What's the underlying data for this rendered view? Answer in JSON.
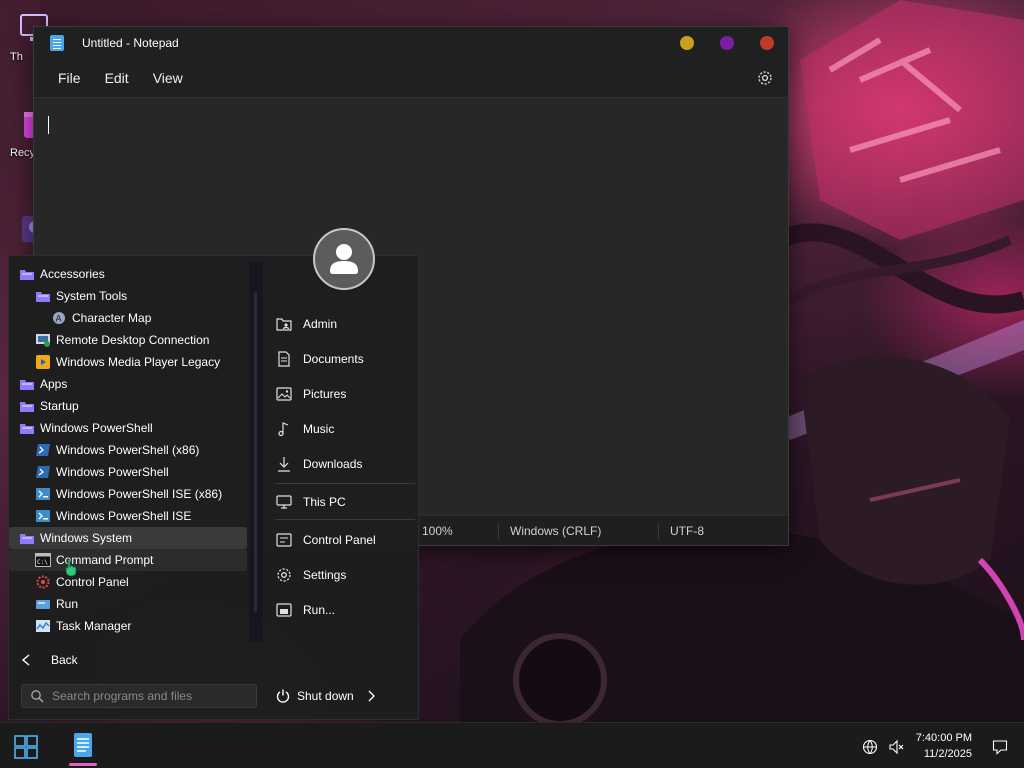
{
  "desktop": {
    "icons": [
      {
        "label": "Th",
        "icon": "this-pc-icon"
      },
      {
        "label": "Recy",
        "icon": "recycle-bin-icon"
      },
      {
        "label": "",
        "icon": "game-shortcut-icon"
      }
    ]
  },
  "notepad": {
    "title": "Untitled - Notepad",
    "menu": [
      "File",
      "Edit",
      "View"
    ],
    "settings_icon": "gear-icon",
    "caption_button_colors": [
      "#c8a21a",
      "#7b1fa2",
      "#c0392b"
    ],
    "editor_text": "",
    "status": {
      "zoom": "100%",
      "line_ending": "Windows (CRLF)",
      "encoding": "UTF-8"
    }
  },
  "start_menu": {
    "tree": [
      {
        "label": "Accessories",
        "icon": "folder-icon"
      },
      {
        "label": "System Tools",
        "icon": "folder-icon"
      },
      {
        "label": "Character Map",
        "icon": "character-map-icon"
      },
      {
        "label": "Remote Desktop Connection",
        "icon": "remote-desktop-icon"
      },
      {
        "label": "Windows Media Player Legacy",
        "icon": "media-player-icon"
      },
      {
        "label": "Apps",
        "icon": "folder-icon"
      },
      {
        "label": "Startup",
        "icon": "folder-icon"
      },
      {
        "label": "Windows PowerShell",
        "icon": "folder-icon"
      },
      {
        "label": "Windows PowerShell (x86)",
        "icon": "powershell-icon"
      },
      {
        "label": "Windows PowerShell",
        "icon": "powershell-icon"
      },
      {
        "label": "Windows PowerShell ISE (x86)",
        "icon": "powershell-ise-icon"
      },
      {
        "label": "Windows PowerShell ISE",
        "icon": "powershell-ise-icon"
      },
      {
        "label": "Windows System",
        "icon": "folder-icon"
      },
      {
        "label": "Command Prompt",
        "icon": "command-prompt-icon"
      },
      {
        "label": "Control Panel",
        "icon": "control-panel-icon"
      },
      {
        "label": "Run",
        "icon": "run-icon"
      },
      {
        "label": "Task Manager",
        "icon": "task-manager-icon"
      }
    ],
    "back_label": "Back",
    "search_placeholder": "Search programs and files",
    "right_items": [
      {
        "label": "Admin",
        "icon": "user-folder-icon"
      },
      {
        "label": "Documents",
        "icon": "document-icon"
      },
      {
        "label": "Pictures",
        "icon": "picture-icon"
      },
      {
        "label": "Music",
        "icon": "music-icon"
      },
      {
        "label": "Downloads",
        "icon": "download-icon"
      },
      {
        "label": "This PC",
        "icon": "computer-icon"
      },
      {
        "label": "Control Panel",
        "icon": "control-panel-icon"
      },
      {
        "label": "Settings",
        "icon": "gear-icon"
      },
      {
        "label": "Run...",
        "icon": "run-icon"
      }
    ],
    "shutdown_label": "Shut down"
  },
  "taskbar": {
    "time": "7:40:00 PM",
    "date": "11/2/2025",
    "pinned": [
      "start-icon",
      "notepad-icon"
    ],
    "accent_color": "#e060c0"
  }
}
